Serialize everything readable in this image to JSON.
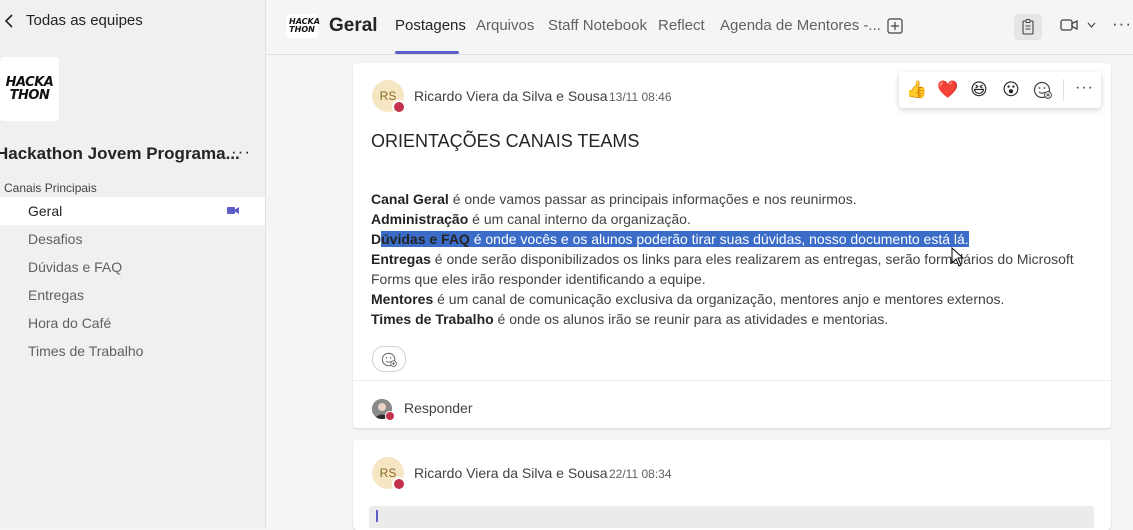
{
  "sidebar": {
    "back_label": "Todas as equipes",
    "logo_text": "HACKA\nTHON",
    "team_name": "Hackathon Jovem Programa...",
    "team_more": "···",
    "section_label": "Canais Principais",
    "channels": [
      {
        "label": "Geral"
      },
      {
        "label": "Desafios"
      },
      {
        "label": "Dúvidas e FAQ"
      },
      {
        "label": "Entregas"
      },
      {
        "label": "Hora do Café"
      },
      {
        "label": "Times de Trabalho"
      }
    ]
  },
  "header": {
    "logo_text": "HACKA THON",
    "title": "Geral",
    "tabs": [
      {
        "label": "Postagens"
      },
      {
        "label": "Arquivos"
      },
      {
        "label": "Staff Notebook"
      },
      {
        "label": "Reflect"
      },
      {
        "label": "Agenda de Mentores -..."
      }
    ],
    "more": "···"
  },
  "posts": [
    {
      "initials": "RS",
      "author": "Ricardo Viera da Silva e Sousa",
      "time": "13/11 08:46",
      "title": "ORIENTAÇÕES CANAIS TEAMS",
      "lines": [
        {
          "bold": "Canal Geral",
          "text": " é onde vamos passar as principais informações e nos reunirmos."
        },
        {
          "bold": "Administração",
          "text": " é um canal interno da organização."
        },
        {
          "bold_pre": "D",
          "bold_sel": "úvidas e FAQ",
          "text": " é onde vocês e os alunos poderão tirar suas dúvidas, nosso documento está lá."
        },
        {
          "bold": "Entregas",
          "text": " é onde serão disponibilizados os links para eles realizarem as entregas, serão formulários do Microsoft"
        },
        {
          "bold": "",
          "text": "Forms que eles irão responder identificando a equipe."
        },
        {
          "bold": "Mentores",
          "text": " é um canal de comunicação exclusiva da organização, mentores anjo e mentores externos."
        },
        {
          "bold": "Times de Trabalho",
          "text": " é onde os alunos irão se reunir para as atividades e mentorias."
        }
      ],
      "reply_label": "Responder"
    },
    {
      "initials": "RS",
      "author": "Ricardo Viera da Silva e Sousa",
      "time": "22/11 08:34"
    }
  ],
  "reactions": [
    "👍",
    "❤️",
    "😆",
    "😮"
  ],
  "reaction_more": "···",
  "colors": {
    "accent": "#5b5fc7",
    "selection": "#3a6cc8",
    "presence_busy": "#c4314b"
  }
}
